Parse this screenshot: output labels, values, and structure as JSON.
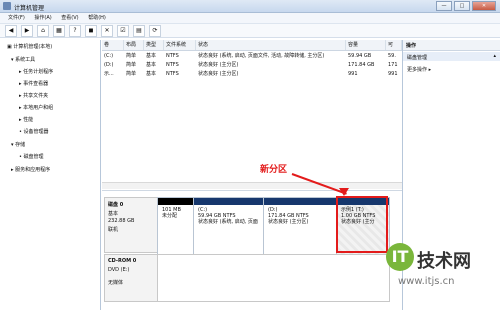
{
  "window": {
    "title": "计算机管理",
    "controls": [
      "—",
      "□",
      "✕"
    ]
  },
  "menu": [
    "文件(F)",
    "操作(A)",
    "查看(V)",
    "帮助(H)"
  ],
  "toolbar": {
    "icons": [
      "back-icon",
      "forward-icon",
      "up-icon",
      "grid-icon",
      "help-icon",
      "disk-icon",
      "delete-icon",
      "properties-icon",
      "view-icon",
      "refresh-icon"
    ]
  },
  "left_tree": [
    {
      "text": "计算机管理(本地)"
    },
    {
      "text": "系统工具"
    },
    {
      "text": "任务计划程序"
    },
    {
      "text": "事件查看器"
    },
    {
      "text": "共享文件夹"
    },
    {
      "text": "本地用户和组"
    },
    {
      "text": "性能"
    },
    {
      "text": "设备管理器"
    },
    {
      "text": "存储"
    },
    {
      "text": "磁盘管理"
    },
    {
      "text": "服务和应用程序"
    }
  ],
  "table": {
    "columns": [
      "卷",
      "布局",
      "类型",
      "文件系统",
      "状态",
      "容量",
      "可"
    ],
    "rows": [
      [
        "(C:)",
        "简单",
        "基本",
        "NTFS",
        "状态良好 (系统, 启动, 页面文件, 活动, 故障转储, 主分区)",
        "59.94 GB",
        "59."
      ],
      [
        "(D:)",
        "简单",
        "基本",
        "NTFS",
        "状态良好 (主分区)",
        "171.84 GB",
        "171"
      ],
      [
        "示...",
        "简单",
        "基本",
        "NTFS",
        "状态良好 (主分区)",
        "991",
        "991"
      ]
    ]
  },
  "disk0": {
    "name": "磁盘 0",
    "type": "基本",
    "size": "232.88 GB",
    "status": "联机",
    "partitions": [
      {
        "label": "101 MB",
        "detail": "未分配"
      },
      {
        "label": "(C:)",
        "detail1": "59.94 GB NTFS",
        "detail2": "状态良好 (系统, 启动, 页面"
      },
      {
        "label": "(D:)",
        "detail1": "171.84 GB NTFS",
        "detail2": "状态良好 (主分区)"
      },
      {
        "label": "示例1 (T:)",
        "detail1": "1.00 GB NTFS",
        "detail2": "状态良好 (主分"
      }
    ]
  },
  "cdrom0": {
    "name": "CD-ROM 0",
    "drive": "DVD (E:)",
    "media": "无媒体"
  },
  "right_pane": {
    "header": "操作",
    "selected": "磁盘管理",
    "more": "更多操作"
  },
  "annotation": {
    "text": "新分区",
    "color": "#e31b1b"
  },
  "watermark": {
    "brand": "技术网",
    "url": "www.itjs.cn"
  }
}
